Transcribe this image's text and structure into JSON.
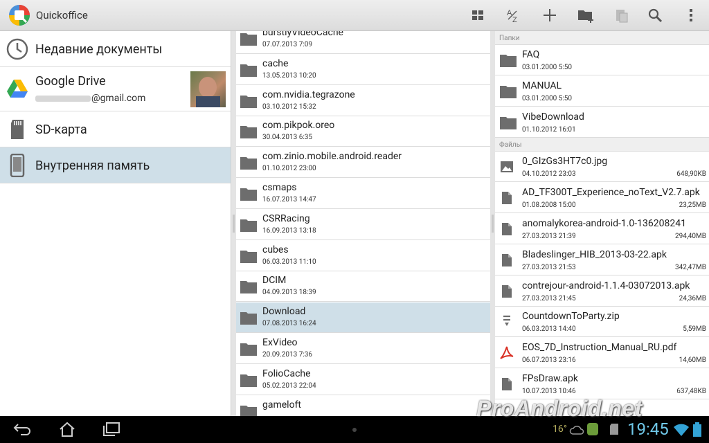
{
  "app": {
    "title": "Quickoffice"
  },
  "toolbar": {
    "icons": [
      "grid-view-icon",
      "sort-az-icon",
      "plus-icon",
      "new-folder-icon",
      "paste-icon",
      "search-icon",
      "overflow-menu-icon"
    ]
  },
  "nav": {
    "recent": "Недавние документы",
    "gdrive": {
      "label": "Google Drive",
      "account": "@gmail.com"
    },
    "sd": "SD-карта",
    "internal": "Внутренняя память"
  },
  "folders": [
    {
      "name": "burstlyVideoCache",
      "date": "07.07.2013 7:09"
    },
    {
      "name": "cache",
      "date": "13.05.2013 10:20"
    },
    {
      "name": "com.nvidia.tegrazone",
      "date": "03.10.2012 15:32"
    },
    {
      "name": "com.pikpok.oreo",
      "date": "30.04.2013 6:35"
    },
    {
      "name": "com.zinio.mobile.android.reader",
      "date": "01.10.2012 23:00"
    },
    {
      "name": "csmaps",
      "date": "16.07.2013 14:47"
    },
    {
      "name": "CSRRacing",
      "date": "16.09.2013 13:18"
    },
    {
      "name": "cubes",
      "date": "06.03.2013 11:10"
    },
    {
      "name": "DCIM",
      "date": "04.09.2013 18:39"
    },
    {
      "name": "Download",
      "date": "07.08.2013 16:24",
      "selected": true
    },
    {
      "name": "ExVideo",
      "date": "20.09.2013 7:36"
    },
    {
      "name": "FolioCache",
      "date": "05.02.2013 22:04"
    },
    {
      "name": "gameloft",
      "date": ""
    }
  ],
  "detail": {
    "folders_header": "Папки",
    "files_header": "Файлы",
    "folders": [
      {
        "name": "FAQ",
        "date": "03.01.2000 5:50"
      },
      {
        "name": "MANUAL",
        "date": "03.01.2000 5:50"
      },
      {
        "name": "VibeDownload",
        "date": "01.10.2012 16:01"
      }
    ],
    "files": [
      {
        "name": "0_GIzGs3HT7c0.jpg",
        "date": "04.10.2012 23:03",
        "size": "648,90КВ",
        "icon": "image-icon"
      },
      {
        "name": "AD_TF300T_Experience_noText_V2.7.apk",
        "date": "01.08.2008 15:00",
        "size": "23,25МВ",
        "icon": "file-icon"
      },
      {
        "name": "anomalykorea-android-1.0-136208241",
        "date": "27.03.2013 21:39",
        "size": "294,40МВ",
        "icon": "file-icon"
      },
      {
        "name": "Bladeslinger_HIB_2013-03-22.apk",
        "date": "27.03.2013 21:53",
        "size": "342,47МВ",
        "icon": "file-icon"
      },
      {
        "name": "contrejour-android-1.1.4-03072013.apk",
        "date": "27.03.2013 21:45",
        "size": "24,36МВ",
        "icon": "file-icon"
      },
      {
        "name": "CountdownToParty.zip",
        "date": "06.03.2013 14:40",
        "size": "5,59МВ",
        "icon": "zip-icon"
      },
      {
        "name": "EOS_7D_Instruction_Manual_RU.pdf",
        "date": "06.07.2013 23:16",
        "size": "14,60МВ",
        "icon": "pdf-icon"
      },
      {
        "name": "FPsDraw.apk",
        "date": "10.07.2013 10:46",
        "size": "637,48КВ",
        "icon": "file-icon"
      }
    ]
  },
  "system": {
    "temperature": "16°",
    "clock": "19:45",
    "watermark": "ProAndroid.net"
  },
  "colors": {
    "selected": "#cfdfe8",
    "clock": "#6fc7e8"
  }
}
